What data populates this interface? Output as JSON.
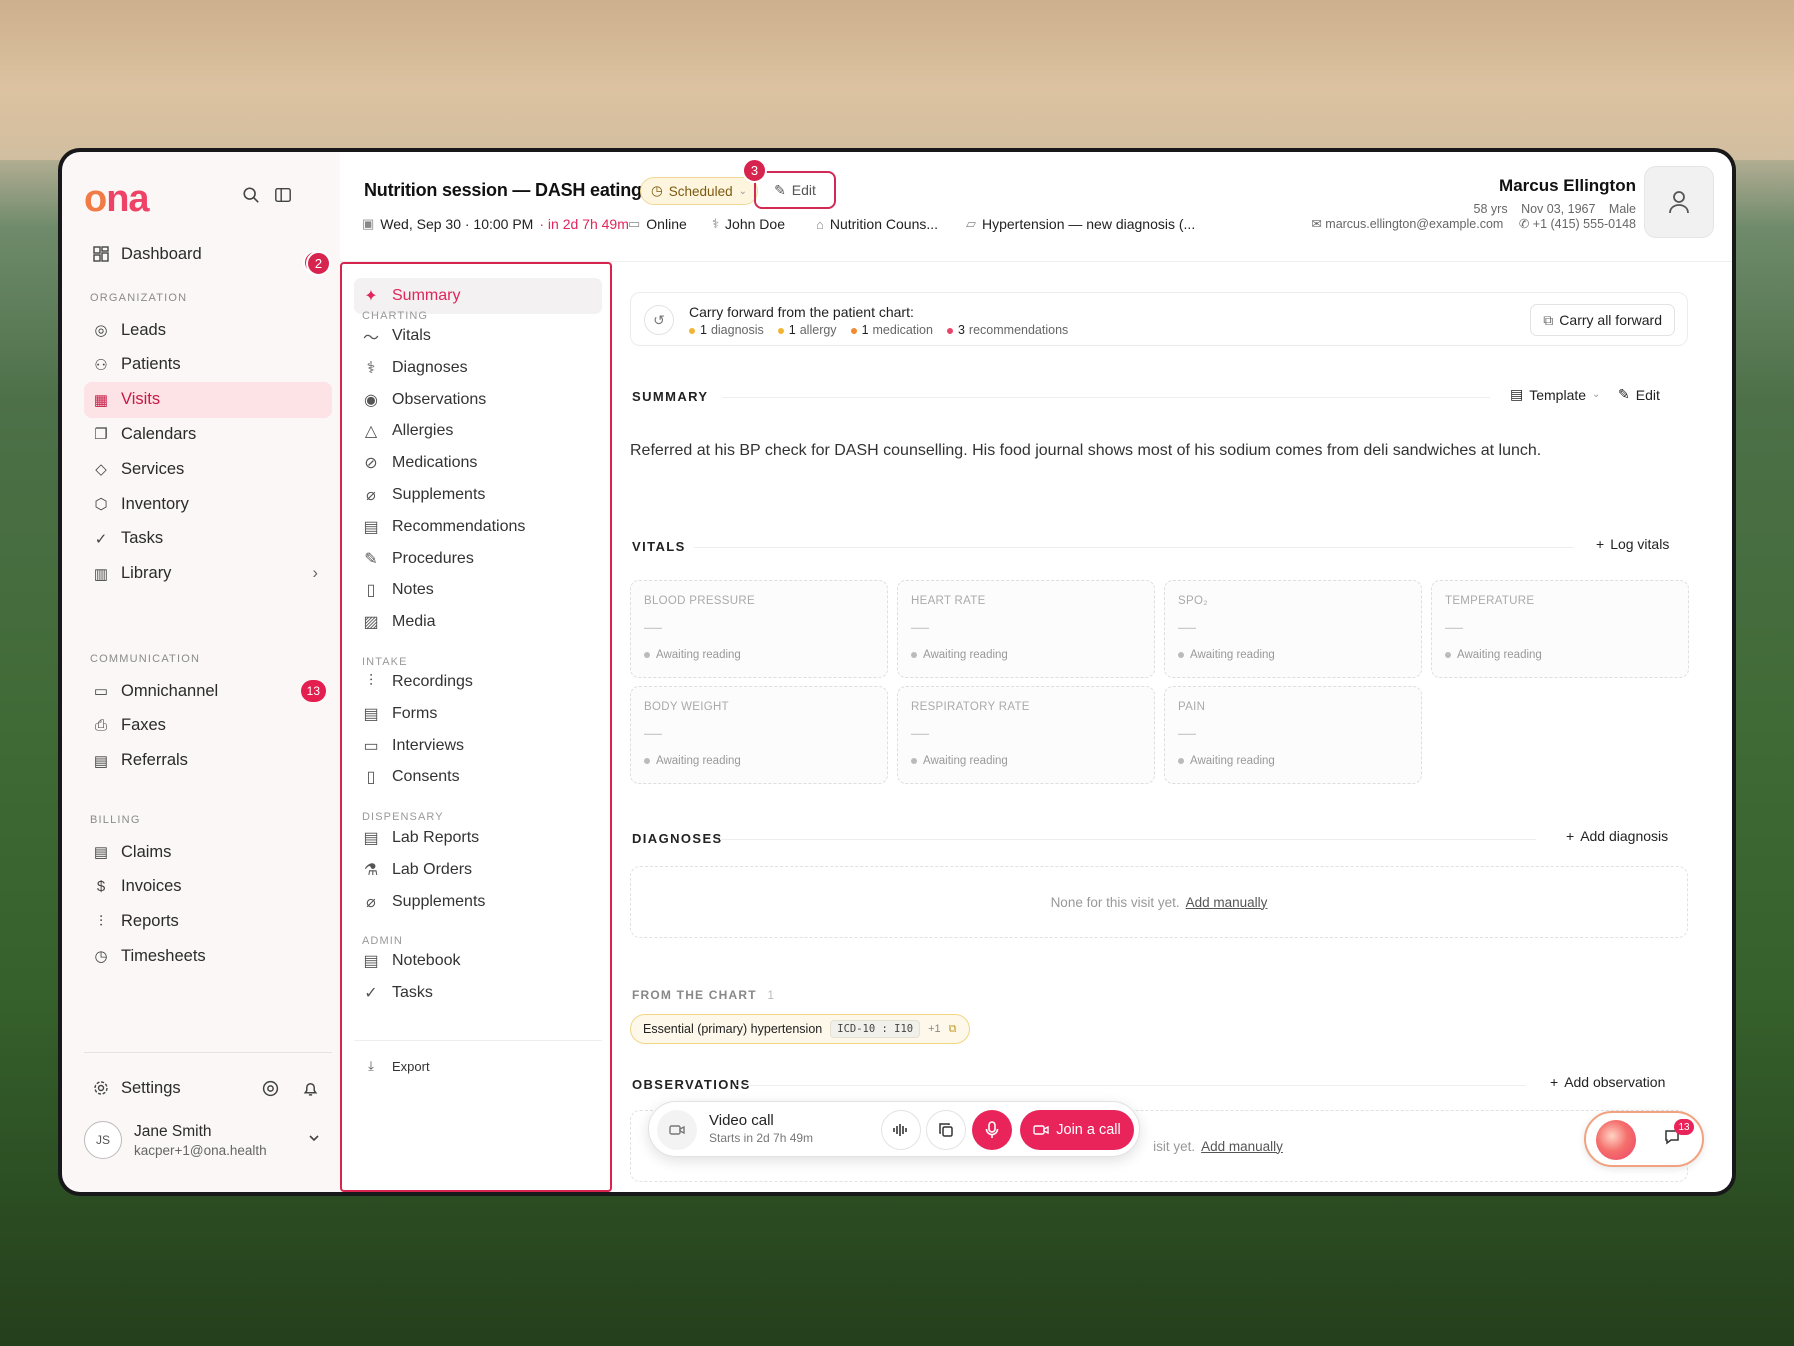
{
  "app": {
    "logo": "ona"
  },
  "sidebar": {
    "dashboard": "Dashboard",
    "dashboard_badge": "2",
    "sections": {
      "organization": "ORGANIZATION",
      "communication": "COMMUNICATION",
      "billing": "BILLING"
    },
    "org_items": [
      {
        "label": "Leads",
        "icon": "target-icon"
      },
      {
        "label": "Patients",
        "icon": "users-icon"
      },
      {
        "label": "Visits",
        "icon": "calendar-icon"
      },
      {
        "label": "Calendars",
        "icon": "calendars-icon"
      },
      {
        "label": "Services",
        "icon": "tag-icon"
      },
      {
        "label": "Inventory",
        "icon": "box-icon"
      },
      {
        "label": "Tasks",
        "icon": "check-circle-icon"
      },
      {
        "label": "Library",
        "icon": "library-icon"
      }
    ],
    "comm_items": [
      {
        "label": "Omnichannel",
        "icon": "chat-icon",
        "badge": "13"
      },
      {
        "label": "Faxes",
        "icon": "printer-icon"
      },
      {
        "label": "Referrals",
        "icon": "file-icon"
      }
    ],
    "billing_items": [
      {
        "label": "Claims",
        "icon": "receipt-icon"
      },
      {
        "label": "Invoices",
        "icon": "invoice-icon"
      },
      {
        "label": "Reports",
        "icon": "chart-icon"
      },
      {
        "label": "Timesheets",
        "icon": "clock-icon"
      }
    ],
    "settings": "Settings",
    "user": {
      "initials": "JS",
      "name": "Jane Smith",
      "email": "kacper+1@ona.health"
    }
  },
  "header": {
    "title": "Nutrition session — DASH eating plan",
    "status": "Scheduled",
    "edit": "Edit",
    "edit_annotation": "3",
    "date": "Wed, Sep 30 · 10:00 PM",
    "countdown": "· in 2d 7h 49m",
    "mode": "Online",
    "provider": "John Doe",
    "service": "Nutrition Couns...",
    "folder": "Hypertension — new diagnosis (...",
    "patient": {
      "name": "Marcus Ellington",
      "age": "58 yrs",
      "dob": "Nov 03, 1967",
      "sex": "Male",
      "email": "marcus.ellington@example.com",
      "phone": "+1 (415) 555-0148"
    }
  },
  "midnav": {
    "active": "Summary",
    "sections": {
      "charting": "CHARTING",
      "intake": "INTAKE",
      "dispensary": "DISPENSARY",
      "admin": "ADMIN"
    },
    "charting": [
      "Vitals",
      "Diagnoses",
      "Observations",
      "Allergies",
      "Medications",
      "Supplements",
      "Recommendations",
      "Procedures",
      "Notes",
      "Media"
    ],
    "intake": [
      "Recordings",
      "Forms",
      "Interviews",
      "Consents"
    ],
    "dispensary": [
      "Lab Reports",
      "Lab Orders",
      "Supplements"
    ],
    "admin": [
      "Notebook",
      "Tasks"
    ],
    "export": "Export"
  },
  "carry": {
    "label": "Carry forward from the patient chart:",
    "items": [
      {
        "n": "1",
        "text": "diagnosis",
        "color": "#f2b533"
      },
      {
        "n": "1",
        "text": "allergy",
        "color": "#f2b533"
      },
      {
        "n": "1",
        "text": "medication",
        "color": "#f28a2e"
      },
      {
        "n": "3",
        "text": "recommendations",
        "color": "#e8456a"
      }
    ],
    "button": "Carry all forward"
  },
  "summary": {
    "heading": "SUMMARY",
    "template": "Template",
    "edit": "Edit",
    "text": "Referred at his BP check for DASH counselling. His food journal shows most of his sodium comes from deli sandwiches at lunch."
  },
  "vitals": {
    "heading": "VITALS",
    "action": "Log vitals",
    "cards": [
      {
        "label": "BLOOD PRESSURE",
        "value": "—",
        "status": "Awaiting reading"
      },
      {
        "label": "HEART RATE",
        "value": "—",
        "status": "Awaiting reading"
      },
      {
        "label": "SPO₂",
        "value": "—",
        "status": "Awaiting reading"
      },
      {
        "label": "TEMPERATURE",
        "value": "—",
        "status": "Awaiting reading"
      },
      {
        "label": "BODY WEIGHT",
        "value": "—",
        "status": "Awaiting reading"
      },
      {
        "label": "RESPIRATORY RATE",
        "value": "—",
        "status": "Awaiting reading"
      },
      {
        "label": "PAIN",
        "value": "—",
        "status": "Awaiting reading"
      }
    ]
  },
  "diagnoses": {
    "heading": "DIAGNOSES",
    "action": "Add diagnosis",
    "empty": "None for this visit yet.",
    "add_manually": "Add manually",
    "from_chart": "FROM THE CHART",
    "from_chart_count": "1",
    "chip": {
      "name": "Essential (primary) hypertension",
      "code": "ICD-10 : I10",
      "extra": "+1"
    }
  },
  "observations": {
    "heading": "OBSERVATIONS",
    "action": "Add observation",
    "empty_tail": "isit yet.",
    "add_manually": "Add manually"
  },
  "call": {
    "title": "Video call",
    "subtitle": "Starts in 2d 7h 49m",
    "join": "Join a call"
  },
  "fab": {
    "badge": "13"
  },
  "annotations": {
    "midnav": "2"
  },
  "colors": {
    "accent": "#e8245a",
    "brand": "#ee4266"
  }
}
